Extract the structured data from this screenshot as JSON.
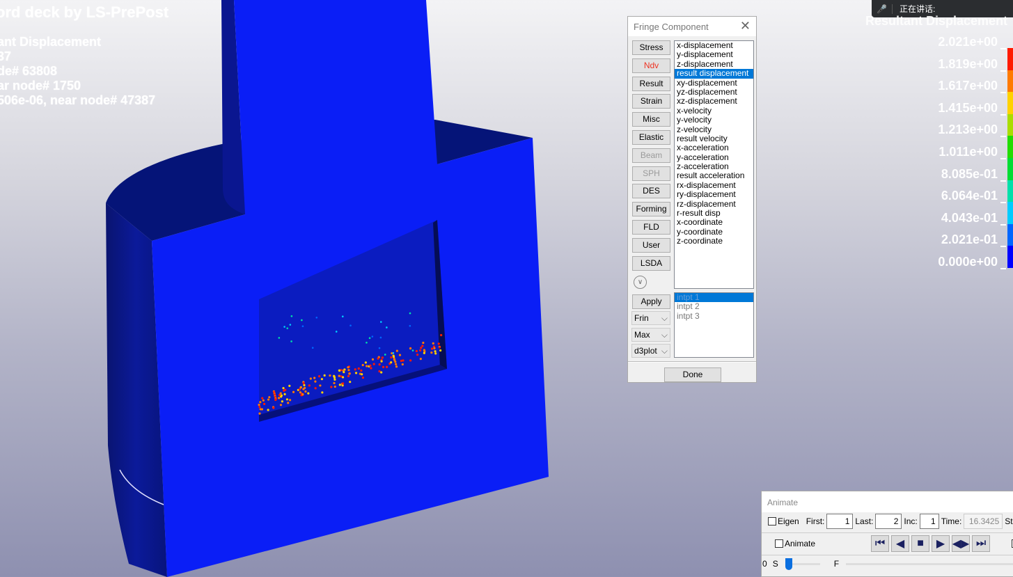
{
  "viewport": {
    "title": "ord deck by LS-PrePost",
    "info_lines": [
      "ant Displacement",
      "37",
      "de# 63808",
      "ar node# 1750",
      "506e-06, near node# 47387"
    ]
  },
  "legend": {
    "title": "Resultant Displacement",
    "labels": [
      "2.021e+00",
      "1.819e+00",
      "1.617e+00",
      "1.415e+00",
      "1.213e+00",
      "1.011e+00",
      "8.085e-01",
      "6.064e-01",
      "4.043e-01",
      "2.021e-01",
      "0.000e+00"
    ],
    "colors_top_to_bottom": [
      "#ff1a00",
      "#ff7a00",
      "#ffd200",
      "#aadd00",
      "#22dd00",
      "#00dd33",
      "#00e0aa",
      "#00ccff",
      "#0066ff",
      "#0000ff"
    ]
  },
  "talk_bar": {
    "icon": "mic-muted-icon",
    "label": "正在讲话:"
  },
  "fringe": {
    "title": "Fringe Component",
    "buttons": [
      {
        "label": "Stress"
      },
      {
        "label": "Ndv",
        "state": "active"
      },
      {
        "label": "Result"
      },
      {
        "label": "Strain"
      },
      {
        "label": "Misc"
      },
      {
        "label": "Elastic"
      },
      {
        "label": "Beam",
        "state": "disabled"
      },
      {
        "label": "SPH",
        "state": "disabled"
      },
      {
        "label": "DES"
      },
      {
        "label": "Forming"
      },
      {
        "label": "FLD"
      },
      {
        "label": "User"
      },
      {
        "label": "LSDA"
      }
    ],
    "components": [
      "x-displacement",
      "y-displacement",
      "z-displacement",
      "result displacement",
      "xy-displacement",
      "yz-displacement",
      "xz-displacement",
      "x-velocity",
      "y-velocity",
      "z-velocity",
      "result velocity",
      "x-acceleration",
      "y-acceleration",
      "z-acceleration",
      "result acceleration",
      "rx-displacement",
      "ry-displacement",
      "rz-displacement",
      "r-result disp",
      "x-coordinate",
      "y-coordinate",
      "z-coordinate"
    ],
    "selected_component": "result displacement",
    "intpts": [
      "intpt   1",
      "intpt   2",
      "intpt   3"
    ],
    "apply": "Apply",
    "dropdowns": [
      "Frin",
      "Max",
      "d3plot"
    ],
    "done": "Done"
  },
  "animate": {
    "title": "Animate",
    "eigen": "Eigen",
    "first_label": "First:",
    "first": "1",
    "last_label": "Last:",
    "last": "2",
    "inc_label": "Inc:",
    "inc": "1",
    "time_label": "Time:",
    "time": "16.3425",
    "state_label": "State",
    "animate_label": "Animate",
    "slider_left": "0",
    "s_label": "S",
    "f_label": "F",
    "slider_value": 0
  }
}
